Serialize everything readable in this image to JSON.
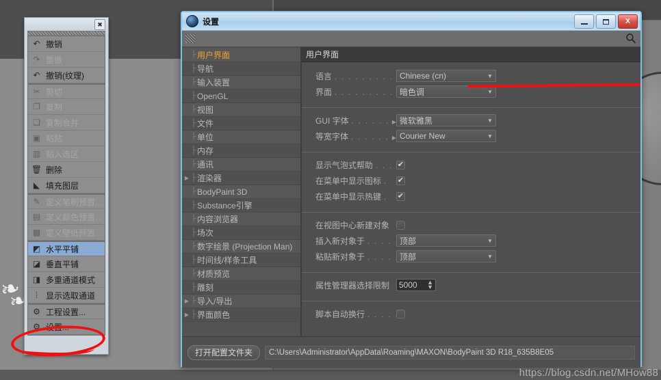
{
  "background": {
    "watermark": "https://blog.csdn.net/MHow88"
  },
  "context_menu": {
    "close_label": "✖",
    "items": [
      {
        "label": "撤销",
        "icon": "undo-icon",
        "glyph": "↶",
        "state": "normal",
        "separator_before": false
      },
      {
        "label": "重做",
        "icon": "redo-icon",
        "glyph": "↷",
        "state": "disabled",
        "separator_before": false
      },
      {
        "label": "撤销(纹理)",
        "icon": "undo-texture-icon",
        "glyph": "↶",
        "state": "normal",
        "separator_before": false
      },
      {
        "label": "剪切",
        "icon": "cut-icon",
        "glyph": "✂",
        "state": "disabled",
        "separator_before": true
      },
      {
        "label": "复制",
        "icon": "copy-icon",
        "glyph": "❐",
        "state": "disabled",
        "separator_before": false
      },
      {
        "label": "复制合并",
        "icon": "copy-merged-icon",
        "glyph": "❏",
        "state": "disabled",
        "separator_before": false
      },
      {
        "label": "粘贴",
        "icon": "paste-icon",
        "glyph": "▣",
        "state": "disabled",
        "separator_before": false
      },
      {
        "label": "贴入选区",
        "icon": "paste-into-icon",
        "glyph": "▥",
        "state": "disabled",
        "separator_before": false
      },
      {
        "label": "删除",
        "icon": "trash-icon",
        "glyph": "🗑",
        "state": "normal",
        "separator_before": false
      },
      {
        "label": "填充图层",
        "icon": "fill-layer-icon",
        "glyph": "◣",
        "state": "normal",
        "separator_before": false
      },
      {
        "label": "定义笔刷预置...",
        "icon": "define-brush-icon",
        "glyph": "✎",
        "state": "disabled",
        "separator_before": true
      },
      {
        "label": "定义颜色预置...",
        "icon": "define-color-icon",
        "glyph": "▤",
        "state": "disabled",
        "separator_before": false
      },
      {
        "label": "定义壁纸预置...",
        "icon": "define-pattern-icon",
        "glyph": "▩",
        "state": "disabled",
        "separator_before": false
      },
      {
        "label": "水平平铺",
        "icon": "tile-horizontal-icon",
        "glyph": "◩",
        "state": "selected",
        "separator_before": true
      },
      {
        "label": "垂直平铺",
        "icon": "tile-vertical-icon",
        "glyph": "◪",
        "state": "normal",
        "separator_before": false
      },
      {
        "label": "多重通道模式",
        "icon": "multi-channel-icon",
        "glyph": "◨",
        "state": "normal",
        "separator_before": false
      },
      {
        "label": "显示选取通道",
        "icon": "show-selection-icon",
        "glyph": "⦙",
        "state": "normal",
        "separator_before": false
      },
      {
        "label": "工程设置...",
        "icon": "project-settings-icon",
        "glyph": "⚙",
        "state": "normal",
        "separator_before": true
      },
      {
        "label": "设置...",
        "icon": "settings-icon",
        "glyph": "⚙",
        "state": "normal",
        "separator_before": false
      }
    ]
  },
  "settings_window": {
    "title": "设置",
    "titlebar_buttons": {
      "minimize": "minimize-button",
      "maximize": "maximize-button",
      "close": "X"
    },
    "toolbar": {
      "search_icon": "search-icon"
    },
    "tree": [
      {
        "label": "用户界面",
        "active": true,
        "expandable": false
      },
      {
        "label": "导航",
        "active": false,
        "expandable": false
      },
      {
        "label": "输入装置",
        "active": false,
        "expandable": false
      },
      {
        "label": "OpenGL",
        "active": false,
        "expandable": false
      },
      {
        "label": "视图",
        "active": false,
        "expandable": false
      },
      {
        "label": "文件",
        "active": false,
        "expandable": false
      },
      {
        "label": "单位",
        "active": false,
        "expandable": false
      },
      {
        "label": "内存",
        "active": false,
        "expandable": false
      },
      {
        "label": "通讯",
        "active": false,
        "expandable": false
      },
      {
        "label": "渲染器",
        "active": false,
        "expandable": true
      },
      {
        "label": "BodyPaint 3D",
        "active": false,
        "expandable": false
      },
      {
        "label": "Substance引擎",
        "active": false,
        "expandable": false
      },
      {
        "label": "内容浏览器",
        "active": false,
        "expandable": false
      },
      {
        "label": "场次",
        "active": false,
        "expandable": false
      },
      {
        "label": "数字绘景 (Projection Man)",
        "active": false,
        "expandable": false
      },
      {
        "label": "时间线/样条工具",
        "active": false,
        "expandable": false
      },
      {
        "label": "材质预览",
        "active": false,
        "expandable": false
      },
      {
        "label": "雕刻",
        "active": false,
        "expandable": false
      },
      {
        "label": "导入/导出",
        "active": false,
        "expandable": true
      },
      {
        "label": "界面颜色",
        "active": false,
        "expandable": true
      }
    ],
    "pane": {
      "header": "用户界面",
      "groups": [
        {
          "rows": [
            {
              "type": "combo",
              "label": "语言",
              "dots": ". . . . . . . . . .",
              "value": "Chinese (cn)",
              "submenu": false
            },
            {
              "type": "combo",
              "label": "界面",
              "dots": ". . . . . . . . . .",
              "value": "暗色调",
              "submenu": false
            }
          ]
        },
        {
          "rows": [
            {
              "type": "combo",
              "label": "GUI 字体",
              "dots": ". . . . . . .",
              "value": "微软雅黑",
              "submenu": true
            },
            {
              "type": "combo",
              "label": "等宽字体",
              "dots": ". . . . . . .",
              "value": "Courier New",
              "submenu": true
            }
          ]
        },
        {
          "rows": [
            {
              "type": "check",
              "label": "显示气泡式帮助",
              "dots": ". . .",
              "checked": true
            },
            {
              "type": "check",
              "label": "在菜单中显示图标",
              "dots": ".",
              "checked": true
            },
            {
              "type": "check",
              "label": "在菜单中显示热键",
              "dots": ".",
              "checked": true
            }
          ]
        },
        {
          "rows": [
            {
              "type": "check",
              "label": "在视图中心新建对象",
              "dots": "",
              "checked": false
            },
            {
              "type": "combo",
              "label": "插入新对象于",
              "dots": ". . . . .",
              "value": "顶部",
              "submenu": false
            },
            {
              "type": "combo",
              "label": "粘贴新对象于",
              "dots": ". . . . .",
              "value": "顶部",
              "submenu": false
            }
          ]
        },
        {
          "rows": [
            {
              "type": "number",
              "label": "属性管理器选择限制",
              "dots": "",
              "value": "5000"
            }
          ]
        },
        {
          "rows": [
            {
              "type": "check",
              "label": "脚本自动换行",
              "dots": ". . . . .",
              "checked": false
            }
          ]
        }
      ]
    },
    "footer": {
      "open_folder_button": "打开配置文件夹",
      "path": "C:\\Users\\Administrator\\AppData\\Roaming\\MAXON\\BodyPaint 3D R18_635B8E05"
    }
  },
  "colors": {
    "accent_selected": "#8aabd4",
    "tree_active": "#f0a030",
    "annotation_red": "#ee1111",
    "window_border": "#82c2e8"
  }
}
